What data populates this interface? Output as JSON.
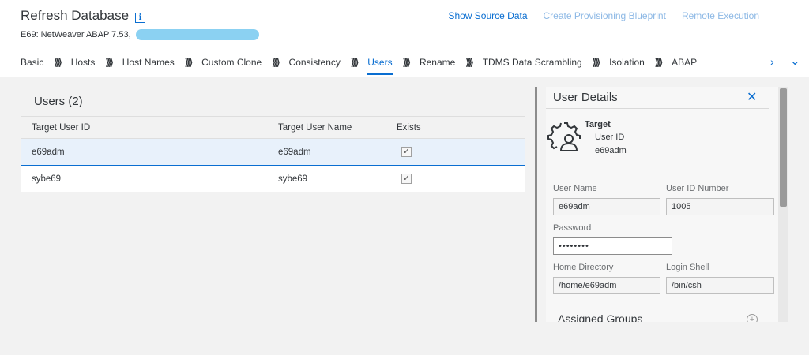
{
  "header": {
    "title": "Refresh Database",
    "subtitle": "E69: NetWeaver ABAP 7.53,",
    "actions": {
      "show_source": "Show Source Data",
      "create_blueprint": "Create Provisioning Blueprint",
      "remote_execution": "Remote Execution"
    }
  },
  "steps": {
    "basic": "Basic",
    "hosts": "Hosts",
    "host_names": "Host Names",
    "custom_clone": "Custom Clone",
    "consistency": "Consistency",
    "users": "Users",
    "rename": "Rename",
    "tdms": "TDMS Data Scrambling",
    "isolation": "Isolation",
    "abap": "ABAP",
    "separator": "⟫⟫",
    "active": "Users"
  },
  "users": {
    "title": "Users (2)",
    "columns": {
      "id": "Target User ID",
      "name": "Target User Name",
      "exists": "Exists"
    },
    "rows": [
      {
        "id": "e69adm",
        "name": "e69adm",
        "exists": true,
        "selected": true
      },
      {
        "id": "sybe69",
        "name": "sybe69",
        "exists": true,
        "selected": false
      }
    ]
  },
  "details": {
    "title": "User Details",
    "target_label": "Target",
    "user_id_label": "User ID",
    "user_id_value": "e69adm",
    "user_name_label": "User Name",
    "user_name_value": "e69adm",
    "uid_number_label": "User ID Number",
    "uid_number_value": "1005",
    "password_label": "Password",
    "password_value": "••••••••",
    "home_dir_label": "Home Directory",
    "home_dir_value": "/home/e69adm",
    "login_shell_label": "Login Shell",
    "login_shell_value": "/bin/csh",
    "groups_title": "Assigned Groups"
  },
  "icons": {
    "info": "info-icon",
    "close": "close-icon",
    "chevron_right": "chevron-right-icon",
    "chevron_down": "chevron-down-icon",
    "user_settings": "user-gear-icon",
    "add": "add-circle-icon",
    "checkmark": "check-icon"
  },
  "colors": {
    "accent": "#0a6ed1",
    "disabled_link": "#8cb8e5",
    "selection": "#e8f1fb"
  }
}
